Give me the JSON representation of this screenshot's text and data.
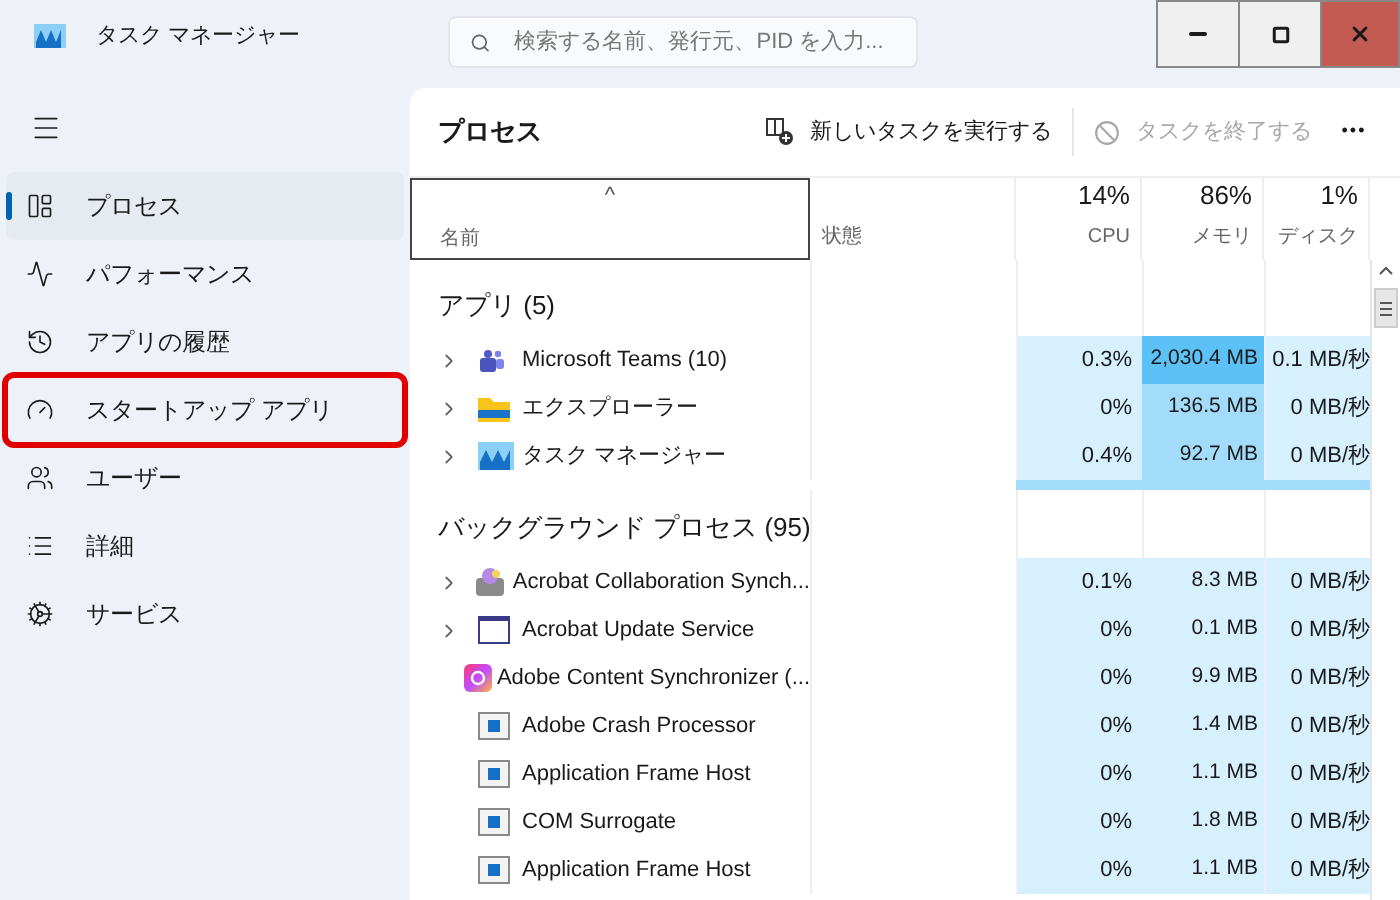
{
  "window": {
    "title": "タスク マネージャー",
    "search": {
      "placeholder": "検索する名前、発行元、PID を入力..."
    }
  },
  "sidebar": {
    "items": [
      {
        "label": "プロセス",
        "kind": "processes",
        "selected": true,
        "highlighted": false
      },
      {
        "label": "パフォーマンス",
        "kind": "performance",
        "selected": false,
        "highlighted": false
      },
      {
        "label": "アプリの履歴",
        "kind": "history",
        "selected": false,
        "highlighted": false
      },
      {
        "label": "スタートアップ アプリ",
        "kind": "startup",
        "selected": false,
        "highlighted": true
      },
      {
        "label": "ユーザー",
        "kind": "users",
        "selected": false,
        "highlighted": false
      },
      {
        "label": "詳細",
        "kind": "details",
        "selected": false,
        "highlighted": false
      },
      {
        "label": "サービス",
        "kind": "services",
        "selected": false,
        "highlighted": false
      }
    ]
  },
  "toolbar": {
    "title": "プロセス",
    "actions": [
      {
        "label": "新しいタスクを実行する",
        "disabled": false
      },
      {
        "label": "タスクを終了する",
        "disabled": true
      }
    ],
    "more": "•••"
  },
  "table": {
    "sort_caret": "^",
    "columns": [
      {
        "label": "名前"
      },
      {
        "label": "状態"
      },
      {
        "label": "CPU",
        "total": "14%"
      },
      {
        "label": "メモリ",
        "total": "86%"
      },
      {
        "label": "ディスク",
        "total": "1%"
      }
    ],
    "groups": [
      {
        "title": "アプリ (5)",
        "more_below": true,
        "rows": [
          {
            "name": "Microsoft Teams (10)",
            "kind": "teams",
            "expandable": true,
            "cpu": "0.3%",
            "memory": "2,030.4 MB",
            "color": "#5cc1f7",
            "disk": "0.1 MB/秒"
          },
          {
            "name": "エクスプローラー",
            "kind": "folder",
            "expandable": true,
            "cpu": "0%",
            "memory": "136.5 MB",
            "color": "#a3dcfb",
            "disk": "0 MB/秒"
          },
          {
            "name": "タスク マネージャー",
            "kind": "taskmgr",
            "expandable": true,
            "cpu": "0.4%",
            "memory": "92.7 MB",
            "color": "#a3dcfb",
            "disk": "0 MB/秒"
          }
        ]
      },
      {
        "title": "バックグラウンド プロセス (95)",
        "more_below": false,
        "rows": [
          {
            "name": "Acrobat Collaboration Synch...",
            "kind": "sync",
            "expandable": true,
            "cpu": "0.1%",
            "memory": "8.3 MB",
            "color": "#d6f0fd",
            "disk": "0 MB/秒"
          },
          {
            "name": "Acrobat Update Service",
            "kind": "window",
            "expandable": true,
            "cpu": "0%",
            "memory": "0.1 MB",
            "color": "#d6f0fd",
            "disk": "0 MB/秒"
          },
          {
            "name": "Adobe Content Synchronizer (...",
            "kind": "creative",
            "expandable": false,
            "cpu": "0%",
            "memory": "9.9 MB",
            "color": "#d6f0fd",
            "disk": "0 MB/秒"
          },
          {
            "name": "Adobe Crash Processor",
            "kind": "app",
            "expandable": false,
            "cpu": "0%",
            "memory": "1.4 MB",
            "color": "#d6f0fd",
            "disk": "0 MB/秒"
          },
          {
            "name": "Application Frame Host",
            "kind": "app",
            "expandable": false,
            "cpu": "0%",
            "memory": "1.1 MB",
            "color": "#d6f0fd",
            "disk": "0 MB/秒"
          },
          {
            "name": "COM Surrogate",
            "kind": "app",
            "expandable": false,
            "cpu": "0%",
            "memory": "1.8 MB",
            "color": "#d6f0fd",
            "disk": "0 MB/秒"
          },
          {
            "name": "Application Frame Host",
            "kind": "app",
            "expandable": false,
            "cpu": "0%",
            "memory": "1.1 MB",
            "color": "#d6f0fd",
            "disk": "0 MB/秒"
          }
        ]
      }
    ]
  }
}
